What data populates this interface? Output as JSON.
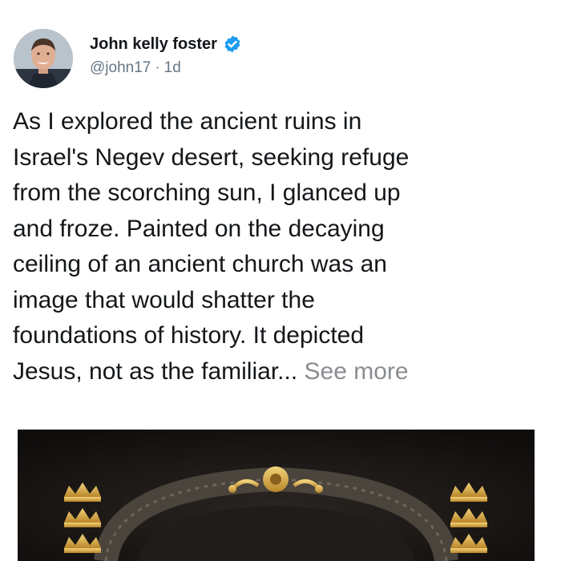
{
  "post": {
    "author": {
      "name": "John kelly foster",
      "verified": true,
      "handle": "@john17",
      "time": "1d",
      "separator": "·"
    },
    "body": {
      "line1": "As I explored the ancient ruins in",
      "line2": "Israel's Negev desert, seeking refuge",
      "line3": "from the scorching sun, I glanced up",
      "line4": "and froze. Painted on the decaying",
      "line5": "ceiling of an ancient church was an",
      "line6": "image that would shatter the",
      "line7": "foundations of history. It depicted",
      "line8": "Jesus, not as the familiar...",
      "see_more": "See more"
    },
    "icons": {
      "verified": "verified-badge-icon",
      "avatar": "profile-photo"
    },
    "colors": {
      "verified_blue": "#1d9bf0",
      "handle_gray": "#657786",
      "see_more_gray": "#8a8d91",
      "text": "#14171a",
      "media_background": "#161412",
      "crown_gold": "#d9a93b"
    }
  }
}
